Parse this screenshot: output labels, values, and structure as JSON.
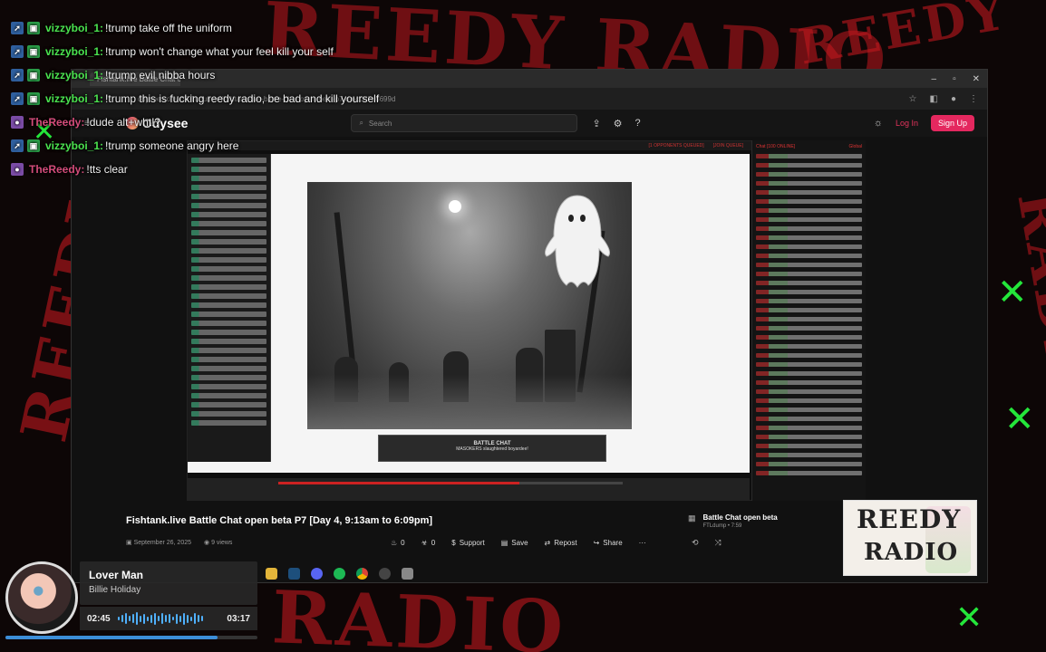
{
  "overlay_chat": [
    {
      "user": "vizzyboi_1:",
      "message": "!trump take off the uniform",
      "color": "green"
    },
    {
      "user": "vizzyboi_1:",
      "message": "!trump won't change what your feel kill your self",
      "color": "green"
    },
    {
      "user": "vizzyboi_1:",
      "message": "!trump evil nibba hours",
      "color": "green"
    },
    {
      "user": "vizzyboi_1:",
      "message": "!trump this is fucking reedy radio, be bad and kill yourself",
      "color": "green"
    },
    {
      "user": "TheReedy:",
      "message": "!dude alt+wht!?",
      "color": "pink"
    },
    {
      "user": "vizzyboi_1:",
      "message": "!trump someone angry here",
      "color": "green"
    },
    {
      "user": "TheReedy:",
      "message": "!tts clear",
      "color": "pink"
    }
  ],
  "browser": {
    "tab_title": "Fishtank.live Battle Chat op...",
    "url": "odysee.com/@FTLdump:f/fishtank-live-battle-chat-open-beta-p7-day:0d2d6699d",
    "site_name": "Odysee",
    "search_placeholder": "Search",
    "login_label": "Log In",
    "signup_label": "Sign Up"
  },
  "video": {
    "header_left": "[1 OPPONENTS QUEUED]",
    "header_right": "[JOIN QUEUE]",
    "popup_title": "BATTLE CHAT",
    "popup_text": "MASOKERS slaughtered boyardee!",
    "side_chat_title": "Chat [100 ONLINE]",
    "side_chat_scope": "Global"
  },
  "video_info": {
    "title": "Fishtank.live Battle Chat open beta P7 [Day 4, 9:13am to 6:09pm]",
    "date": "September 26, 2025",
    "views": "9 views",
    "fires": "0",
    "slimes": "0",
    "support_label": "Support",
    "save_label": "Save",
    "repost_label": "Repost",
    "share_label": "Share",
    "more_label": "···"
  },
  "up_next": {
    "title": "Battle Chat open beta",
    "channel": "FTLdump • 7:59"
  },
  "logo": {
    "line1": "REEDY",
    "line2": "RADIO"
  },
  "now_playing": {
    "title": "Lover Man",
    "artist": "Billie Holiday",
    "elapsed": "02:45",
    "total": "03:17",
    "progress": 0.84
  },
  "colors": {
    "accent": "#e4285f",
    "scribble": "#c0181e",
    "x_mark": "#24e63a"
  }
}
